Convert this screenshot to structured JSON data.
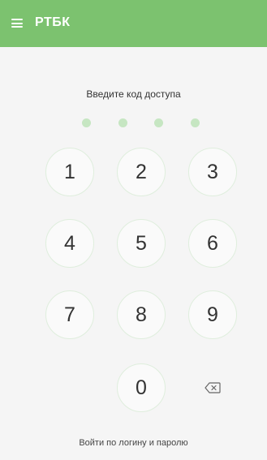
{
  "appbar": {
    "title": "РТБК",
    "menu_icon": "hamburger-menu-icon",
    "color": "#7cc26f"
  },
  "pin": {
    "prompt": "Введите код доступа",
    "dot_count": 4,
    "dot_color": "#c6e6c2"
  },
  "keypad": {
    "keys": [
      "1",
      "2",
      "3",
      "4",
      "5",
      "6",
      "7",
      "8",
      "9",
      "0"
    ],
    "backspace_icon": "backspace-icon"
  },
  "footer": {
    "login_link": "Войти по логину и паролю"
  }
}
